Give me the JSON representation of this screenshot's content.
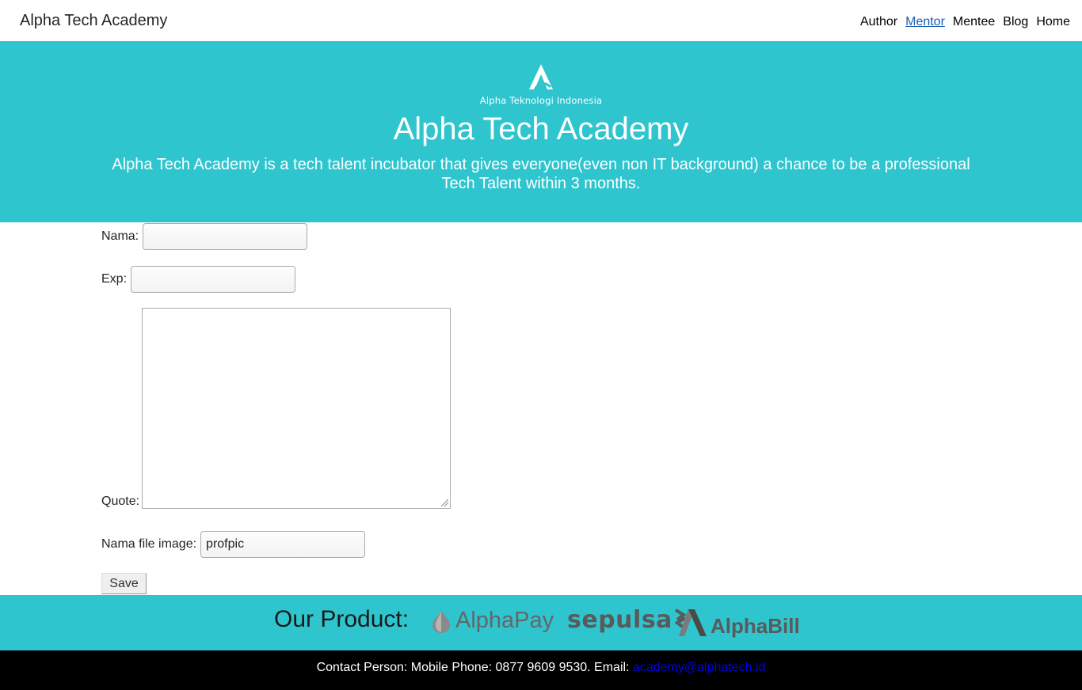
{
  "navbar": {
    "brand": "Alpha Tech Academy",
    "links": [
      {
        "label": "Author",
        "active": false
      },
      {
        "label": "Mentor",
        "active": true
      },
      {
        "label": "Mentee",
        "active": false
      },
      {
        "label": "Blog",
        "active": false
      },
      {
        "label": "Home",
        "active": false
      }
    ]
  },
  "hero": {
    "logo_text": "Alpha Teknologi Indonesia",
    "title": "Alpha Tech Academy",
    "description": "Alpha Tech Academy is a tech talent incubator that gives everyone(even non IT background) a chance to be a professional Tech Talent within 3 months.",
    "background_color": "#2ec5cf"
  },
  "form": {
    "nama_label": "Nama:",
    "nama_value": "",
    "exp_label": "Exp:",
    "exp_value": "",
    "quote_label": "Quote:",
    "quote_value": "",
    "image_label": "Nama file image:",
    "image_value": "profpic",
    "save_label": "Save"
  },
  "products": {
    "title": "Our Product:",
    "items": [
      {
        "name": "AlphaPay",
        "icon": "alphapay-logo-icon"
      },
      {
        "name": "sepulsa",
        "icon": "sepulsa-logo-icon"
      },
      {
        "name": "AlphaBill",
        "icon": "alphabill-logo-icon"
      }
    ]
  },
  "contact": {
    "text": "Contact Person: Mobile Phone: 0877 9609 9530. Email: ",
    "email": "academy@alphatech.id"
  }
}
